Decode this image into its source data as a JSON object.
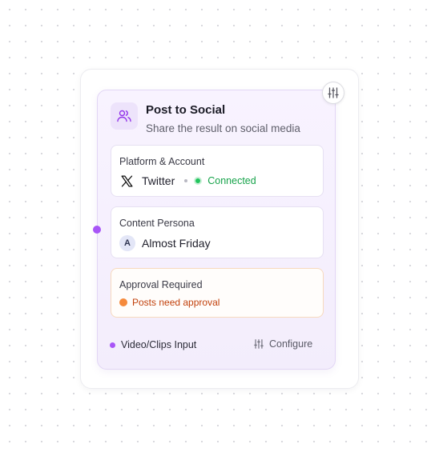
{
  "node": {
    "title": "Post to Social",
    "subtitle": "Share the result on social media",
    "header_icon": "users-icon",
    "settings_icon": "sliders-icon"
  },
  "platform": {
    "label": "Platform & Account",
    "icon": "x-logo-icon",
    "name": "Twitter",
    "status": "Connected",
    "status_color": "#22c55e"
  },
  "persona": {
    "label": "Content Persona",
    "avatar_initial": "A",
    "name": "Almost Friday"
  },
  "approval": {
    "label": "Approval Required",
    "status": "Posts need approval",
    "status_color": "#f58a3c"
  },
  "footer": {
    "input_label": "Video/Clips Input",
    "configure_label": "Configure",
    "configure_icon": "sliders-icon"
  },
  "colors": {
    "accent": "#a855f7",
    "node_background": "#f6f0fe"
  }
}
